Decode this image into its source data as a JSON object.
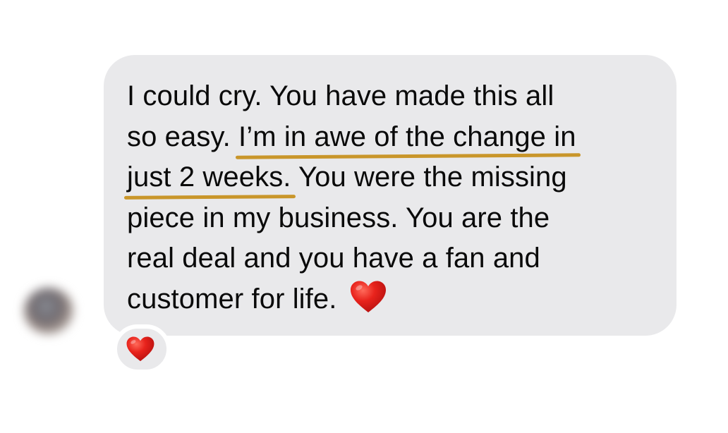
{
  "message": {
    "lines": {
      "l1": "I could cry. You have made this all",
      "l2_pre": "so easy. ",
      "l2_hl": "I’m in awe of the change in",
      "l3_hl": "just 2 weeks.",
      "l3_post": " You were the missing",
      "l4": "piece in my business. You are the",
      "l5": "real deal and you have a fan and",
      "l6": "customer for life."
    },
    "inline_emoji": "red-heart-icon"
  },
  "reaction": {
    "emoji": "red-heart-icon"
  },
  "colors": {
    "bubble": "#e9e9eb",
    "text": "#0a0a0a",
    "highlight_underline": "#c9962a",
    "heart": "#e0201c"
  }
}
